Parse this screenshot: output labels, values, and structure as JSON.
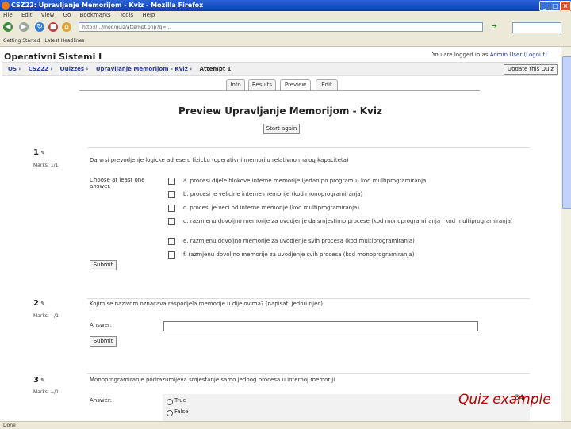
{
  "window": {
    "title": "CSZ22: Upravljanje Memorijom - Kviz - Mozilla Firefox"
  },
  "menu": [
    "File",
    "Edit",
    "View",
    "Go",
    "Bookmarks",
    "Tools",
    "Help"
  ],
  "address": {
    "url": "http://.../mod/quiz/attempt.php?q=..."
  },
  "bookmarks": [
    "Getting Started",
    "Latest Headlines"
  ],
  "site": {
    "name": "Operativni Sistemi I",
    "login_prefix": "You are logged in as ",
    "login_user": "Admin User",
    "logout": "(Logout)"
  },
  "breadcrumb": [
    "OS",
    "CSZ22",
    "Quizzes",
    "Upravljanje Memorijom - Kviz"
  ],
  "breadcrumb_current": "Attempt 1",
  "update_button": "Update this Quiz",
  "tabs": [
    "Info",
    "Results",
    "Preview",
    "Edit"
  ],
  "page_title": "Preview Upravljanje Memorijom - Kviz",
  "start_again": "Start again",
  "questions": [
    {
      "number": "1",
      "marks": "Marks: 1/1",
      "text": "Da vrsi prevodjenje logicke adrese u fizicku (operativni memoriju relativno malog kapaciteta)",
      "label": "Choose at least one answer.",
      "options": [
        "a. procesi dijele blokove interne memorije (jedan po programu) kod multiprogramiranja",
        "b. procesi je velicine interne memorije (kod monoprogramiranja)",
        "c. procesi je veci od interne memorije (kod multiprogramiranja)",
        "d. razmjenu dovoljno memorije za uvodjenje da smjestimo procese (kod monoprogramiranja i kod multiprogramiranja)",
        "e. razmjenu dovoljno memorije za uvodjenje svih procesa (kod multiprogramiranja)",
        "f. razmjenu dovoljno memorije za uvodjenje svih procesa (kod monoprogramiranja)"
      ],
      "submit": "Submit"
    },
    {
      "number": "2",
      "marks": "Marks: --/1",
      "text": "Kojim se nazivom oznacava raspodjela memorije u dijelovima? (napisati jednu rijec)",
      "label": "Answer:",
      "submit": "Submit"
    },
    {
      "number": "3",
      "marks": "Marks: --/1",
      "text": "Monoprogramiranje podrazumijeva smjestanje samo jednog procesa u internoj memoriji.",
      "label": "Answer:",
      "options": [
        "True",
        "False"
      ]
    }
  ],
  "status": "Done",
  "caption": "Quiz example",
  "page_number": "34"
}
